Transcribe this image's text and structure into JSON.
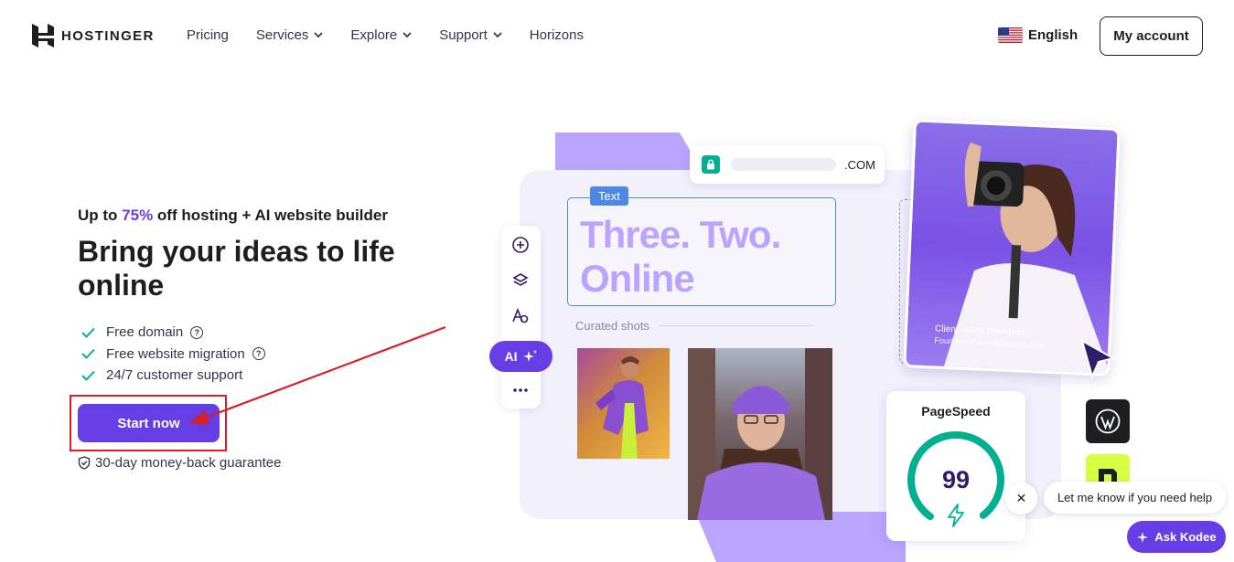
{
  "header": {
    "logo_text": "HOSTINGER",
    "nav": [
      {
        "label": "Pricing",
        "has_dropdown": false
      },
      {
        "label": "Services",
        "has_dropdown": true
      },
      {
        "label": "Explore",
        "has_dropdown": true
      },
      {
        "label": "Support",
        "has_dropdown": true
      },
      {
        "label": "Horizons",
        "has_dropdown": false
      }
    ],
    "language": "English",
    "account_button": "My account"
  },
  "hero": {
    "promo_prefix": "Up to ",
    "promo_percent": "75%",
    "promo_suffix": " off hosting + AI website builder",
    "headline": "Bring your ideas to life online",
    "features": [
      {
        "text": "Free domain",
        "info": true
      },
      {
        "text": "Free website migration",
        "info": true
      },
      {
        "text": "24/7 customer support",
        "info": false
      }
    ],
    "cta_label": "Start now",
    "guarantee": "30-day money-back guarantee"
  },
  "illustration": {
    "url_tld": ".COM",
    "text_tag": "Text",
    "big_text_line1": "Three. Two.",
    "big_text_line2": "Online",
    "curated_label": "Curated shots",
    "ai_label": "AI",
    "client_name": "Client: Anna Franques",
    "client_role": "Founder of annafranques.com",
    "pagespeed_title": "PageSpeed",
    "pagespeed_score": "99",
    "pagespeed_value": 0.99
  },
  "chat": {
    "close_symbol": "✕",
    "bubble_text": "Let me know if you need help",
    "ask_label": "Ask Kodee"
  },
  "colors": {
    "brand": "#673de6",
    "highlight_border": "#d61f26",
    "check_green": "#00b090",
    "lavender": "#b9a4ff"
  }
}
